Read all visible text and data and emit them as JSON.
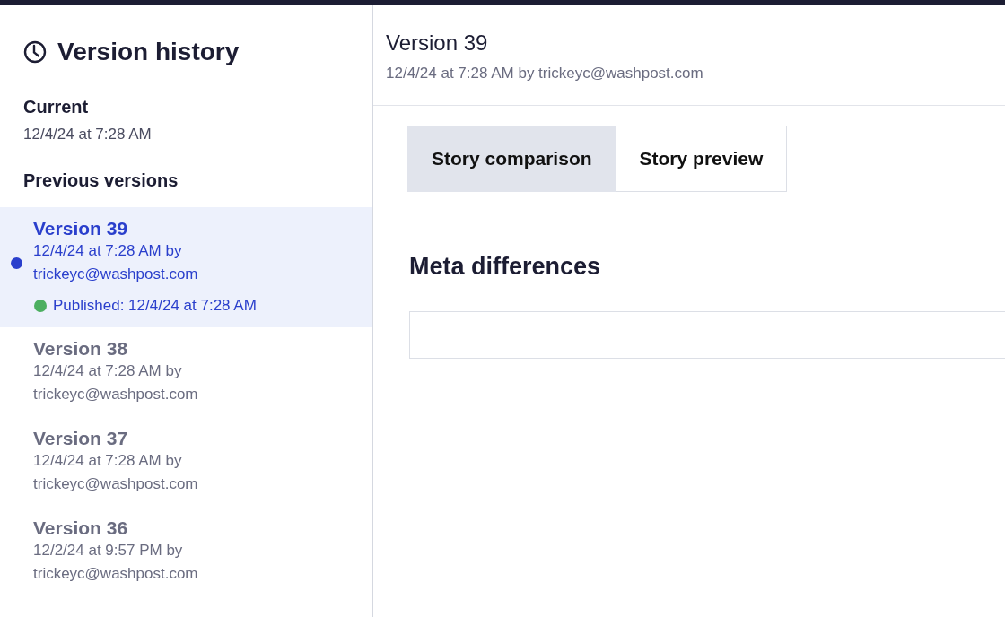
{
  "sidebar": {
    "title": "Version history",
    "current": {
      "label": "Current",
      "time": "12/4/24 at 7:28 AM"
    },
    "previous_label": "Previous versions",
    "versions": [
      {
        "title": "Version 39",
        "meta": "12/4/24 at 7:28 AM by trickeyc@washpost.com",
        "published": "Published: 12/4/24 at 7:28 AM",
        "selected": true
      },
      {
        "title": "Version 38",
        "meta": "12/4/24 at 7:28 AM by trickeyc@washpost.com",
        "selected": false
      },
      {
        "title": "Version 37",
        "meta": "12/4/24 at 7:28 AM by trickeyc@washpost.com",
        "selected": false
      },
      {
        "title": "Version 36",
        "meta": "12/2/24 at 9:57 PM by trickeyc@washpost.com",
        "selected": false
      }
    ]
  },
  "detail": {
    "title": "Version 39",
    "meta": "12/4/24 at 7:28 AM by trickeyc@washpost.com",
    "tabs": [
      {
        "label": "Story comparison",
        "selected": true
      },
      {
        "label": "Story preview",
        "selected": false
      }
    ],
    "section_title": "Meta differences"
  }
}
